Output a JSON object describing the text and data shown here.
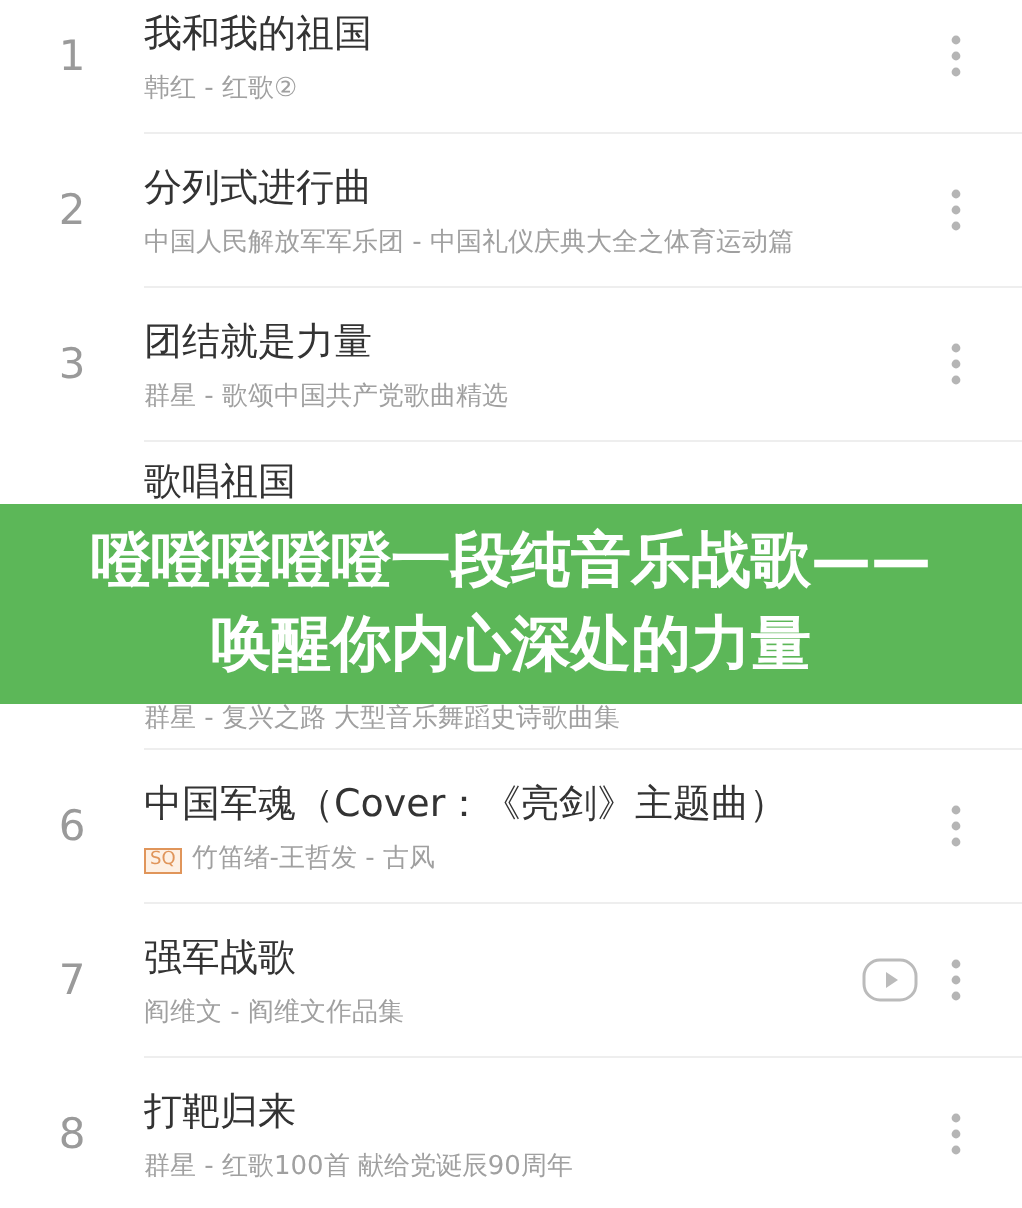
{
  "songs": [
    {
      "kind": "full",
      "number": "1",
      "title": "我和我的祖国",
      "subtitle": "韩红 - 红歌②",
      "play_button": false
    },
    {
      "kind": "full",
      "number": "2",
      "title": "分列式进行曲",
      "subtitle": "中国人民解放军军乐团 - 中国礼仪庆典大全之体育运动篇",
      "play_button": false
    },
    {
      "kind": "full",
      "number": "3",
      "title": "团结就是力量",
      "subtitle": "群星 - 歌颂中国共产党歌曲精选",
      "play_button": false
    },
    {
      "kind": "title_only",
      "title": "歌唱祖国"
    },
    {
      "kind": "subtitle_only",
      "subtitle": "群星 - 复兴之路 大型音乐舞蹈史诗歌曲集"
    },
    {
      "kind": "full",
      "number": "6",
      "title": "中国军魂（Cover：《亮剑》主题曲）",
      "badge": "SQ",
      "subtitle": "竹笛绪-王哲发 - 古风",
      "play_button": false
    },
    {
      "kind": "full",
      "number": "7",
      "title": "强军战歌",
      "subtitle": "阎维文 - 阎维文作品集",
      "play_button": true
    },
    {
      "kind": "full",
      "number": "8",
      "title": "打靶归来",
      "subtitle": "群星 - 红歌100首 献给党诞辰90周年",
      "play_button": false
    }
  ],
  "banner": {
    "headline": "噔噔噔噔噔一段纯音乐战歌——唤醒你内心深处的力量"
  }
}
